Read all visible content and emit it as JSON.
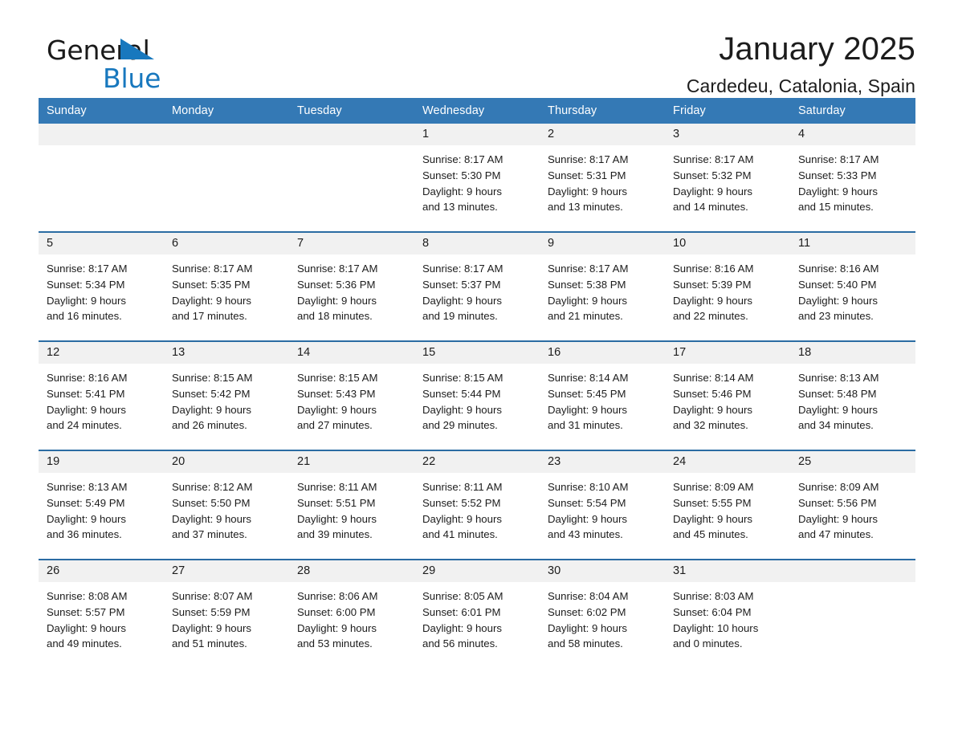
{
  "brand": {
    "logo_word1": "General",
    "logo_word2": "Blue",
    "accent_color": "#1878be",
    "header_color": "#3479b5",
    "separator_color": "#2b6ca3"
  },
  "header": {
    "title": "January 2025",
    "subtitle": "Cardedeu, Catalonia, Spain"
  },
  "calendar": {
    "weekday_headers": [
      "Sunday",
      "Monday",
      "Tuesday",
      "Wednesday",
      "Thursday",
      "Friday",
      "Saturday"
    ],
    "weeks": [
      [
        {
          "day": "",
          "sunrise": "",
          "sunset": "",
          "daylight_line1": "",
          "daylight_line2": ""
        },
        {
          "day": "",
          "sunrise": "",
          "sunset": "",
          "daylight_line1": "",
          "daylight_line2": ""
        },
        {
          "day": "",
          "sunrise": "",
          "sunset": "",
          "daylight_line1": "",
          "daylight_line2": ""
        },
        {
          "day": "1",
          "sunrise": "Sunrise: 8:17 AM",
          "sunset": "Sunset: 5:30 PM",
          "daylight_line1": "Daylight: 9 hours",
          "daylight_line2": "and 13 minutes."
        },
        {
          "day": "2",
          "sunrise": "Sunrise: 8:17 AM",
          "sunset": "Sunset: 5:31 PM",
          "daylight_line1": "Daylight: 9 hours",
          "daylight_line2": "and 13 minutes."
        },
        {
          "day": "3",
          "sunrise": "Sunrise: 8:17 AM",
          "sunset": "Sunset: 5:32 PM",
          "daylight_line1": "Daylight: 9 hours",
          "daylight_line2": "and 14 minutes."
        },
        {
          "day": "4",
          "sunrise": "Sunrise: 8:17 AM",
          "sunset": "Sunset: 5:33 PM",
          "daylight_line1": "Daylight: 9 hours",
          "daylight_line2": "and 15 minutes."
        }
      ],
      [
        {
          "day": "5",
          "sunrise": "Sunrise: 8:17 AM",
          "sunset": "Sunset: 5:34 PM",
          "daylight_line1": "Daylight: 9 hours",
          "daylight_line2": "and 16 minutes."
        },
        {
          "day": "6",
          "sunrise": "Sunrise: 8:17 AM",
          "sunset": "Sunset: 5:35 PM",
          "daylight_line1": "Daylight: 9 hours",
          "daylight_line2": "and 17 minutes."
        },
        {
          "day": "7",
          "sunrise": "Sunrise: 8:17 AM",
          "sunset": "Sunset: 5:36 PM",
          "daylight_line1": "Daylight: 9 hours",
          "daylight_line2": "and 18 minutes."
        },
        {
          "day": "8",
          "sunrise": "Sunrise: 8:17 AM",
          "sunset": "Sunset: 5:37 PM",
          "daylight_line1": "Daylight: 9 hours",
          "daylight_line2": "and 19 minutes."
        },
        {
          "day": "9",
          "sunrise": "Sunrise: 8:17 AM",
          "sunset": "Sunset: 5:38 PM",
          "daylight_line1": "Daylight: 9 hours",
          "daylight_line2": "and 21 minutes."
        },
        {
          "day": "10",
          "sunrise": "Sunrise: 8:16 AM",
          "sunset": "Sunset: 5:39 PM",
          "daylight_line1": "Daylight: 9 hours",
          "daylight_line2": "and 22 minutes."
        },
        {
          "day": "11",
          "sunrise": "Sunrise: 8:16 AM",
          "sunset": "Sunset: 5:40 PM",
          "daylight_line1": "Daylight: 9 hours",
          "daylight_line2": "and 23 minutes."
        }
      ],
      [
        {
          "day": "12",
          "sunrise": "Sunrise: 8:16 AM",
          "sunset": "Sunset: 5:41 PM",
          "daylight_line1": "Daylight: 9 hours",
          "daylight_line2": "and 24 minutes."
        },
        {
          "day": "13",
          "sunrise": "Sunrise: 8:15 AM",
          "sunset": "Sunset: 5:42 PM",
          "daylight_line1": "Daylight: 9 hours",
          "daylight_line2": "and 26 minutes."
        },
        {
          "day": "14",
          "sunrise": "Sunrise: 8:15 AM",
          "sunset": "Sunset: 5:43 PM",
          "daylight_line1": "Daylight: 9 hours",
          "daylight_line2": "and 27 minutes."
        },
        {
          "day": "15",
          "sunrise": "Sunrise: 8:15 AM",
          "sunset": "Sunset: 5:44 PM",
          "daylight_line1": "Daylight: 9 hours",
          "daylight_line2": "and 29 minutes."
        },
        {
          "day": "16",
          "sunrise": "Sunrise: 8:14 AM",
          "sunset": "Sunset: 5:45 PM",
          "daylight_line1": "Daylight: 9 hours",
          "daylight_line2": "and 31 minutes."
        },
        {
          "day": "17",
          "sunrise": "Sunrise: 8:14 AM",
          "sunset": "Sunset: 5:46 PM",
          "daylight_line1": "Daylight: 9 hours",
          "daylight_line2": "and 32 minutes."
        },
        {
          "day": "18",
          "sunrise": "Sunrise: 8:13 AM",
          "sunset": "Sunset: 5:48 PM",
          "daylight_line1": "Daylight: 9 hours",
          "daylight_line2": "and 34 minutes."
        }
      ],
      [
        {
          "day": "19",
          "sunrise": "Sunrise: 8:13 AM",
          "sunset": "Sunset: 5:49 PM",
          "daylight_line1": "Daylight: 9 hours",
          "daylight_line2": "and 36 minutes."
        },
        {
          "day": "20",
          "sunrise": "Sunrise: 8:12 AM",
          "sunset": "Sunset: 5:50 PM",
          "daylight_line1": "Daylight: 9 hours",
          "daylight_line2": "and 37 minutes."
        },
        {
          "day": "21",
          "sunrise": "Sunrise: 8:11 AM",
          "sunset": "Sunset: 5:51 PM",
          "daylight_line1": "Daylight: 9 hours",
          "daylight_line2": "and 39 minutes."
        },
        {
          "day": "22",
          "sunrise": "Sunrise: 8:11 AM",
          "sunset": "Sunset: 5:52 PM",
          "daylight_line1": "Daylight: 9 hours",
          "daylight_line2": "and 41 minutes."
        },
        {
          "day": "23",
          "sunrise": "Sunrise: 8:10 AM",
          "sunset": "Sunset: 5:54 PM",
          "daylight_line1": "Daylight: 9 hours",
          "daylight_line2": "and 43 minutes."
        },
        {
          "day": "24",
          "sunrise": "Sunrise: 8:09 AM",
          "sunset": "Sunset: 5:55 PM",
          "daylight_line1": "Daylight: 9 hours",
          "daylight_line2": "and 45 minutes."
        },
        {
          "day": "25",
          "sunrise": "Sunrise: 8:09 AM",
          "sunset": "Sunset: 5:56 PM",
          "daylight_line1": "Daylight: 9 hours",
          "daylight_line2": "and 47 minutes."
        }
      ],
      [
        {
          "day": "26",
          "sunrise": "Sunrise: 8:08 AM",
          "sunset": "Sunset: 5:57 PM",
          "daylight_line1": "Daylight: 9 hours",
          "daylight_line2": "and 49 minutes."
        },
        {
          "day": "27",
          "sunrise": "Sunrise: 8:07 AM",
          "sunset": "Sunset: 5:59 PM",
          "daylight_line1": "Daylight: 9 hours",
          "daylight_line2": "and 51 minutes."
        },
        {
          "day": "28",
          "sunrise": "Sunrise: 8:06 AM",
          "sunset": "Sunset: 6:00 PM",
          "daylight_line1": "Daylight: 9 hours",
          "daylight_line2": "and 53 minutes."
        },
        {
          "day": "29",
          "sunrise": "Sunrise: 8:05 AM",
          "sunset": "Sunset: 6:01 PM",
          "daylight_line1": "Daylight: 9 hours",
          "daylight_line2": "and 56 minutes."
        },
        {
          "day": "30",
          "sunrise": "Sunrise: 8:04 AM",
          "sunset": "Sunset: 6:02 PM",
          "daylight_line1": "Daylight: 9 hours",
          "daylight_line2": "and 58 minutes."
        },
        {
          "day": "31",
          "sunrise": "Sunrise: 8:03 AM",
          "sunset": "Sunset: 6:04 PM",
          "daylight_line1": "Daylight: 10 hours",
          "daylight_line2": "and 0 minutes."
        },
        {
          "day": "",
          "sunrise": "",
          "sunset": "",
          "daylight_line1": "",
          "daylight_line2": ""
        }
      ]
    ]
  }
}
